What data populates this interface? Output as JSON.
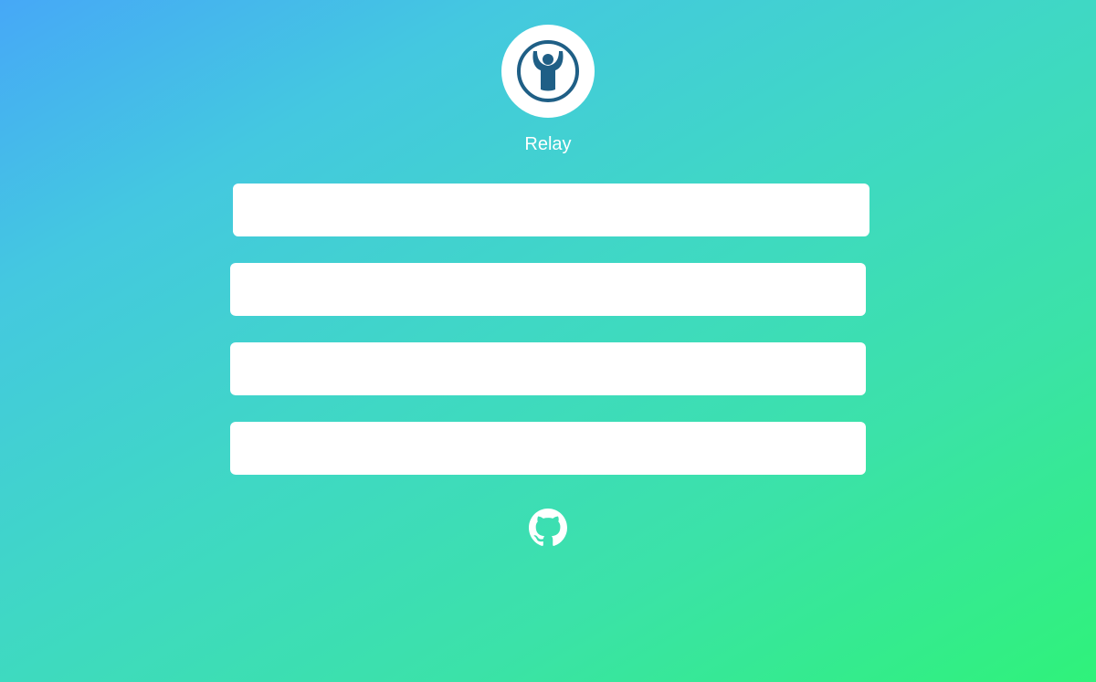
{
  "app": {
    "name": "Relay",
    "logo_icon": "person-raising-arms-icon",
    "logo_color": "#1f5f86"
  },
  "rows": [
    {
      "label": ""
    },
    {
      "label": ""
    },
    {
      "label": ""
    },
    {
      "label": ""
    }
  ],
  "footer": {
    "link_icon": "github-icon"
  },
  "colors": {
    "gradient_start": "#46a8f7",
    "gradient_end": "#2ff27a",
    "panel": "#ffffff"
  }
}
